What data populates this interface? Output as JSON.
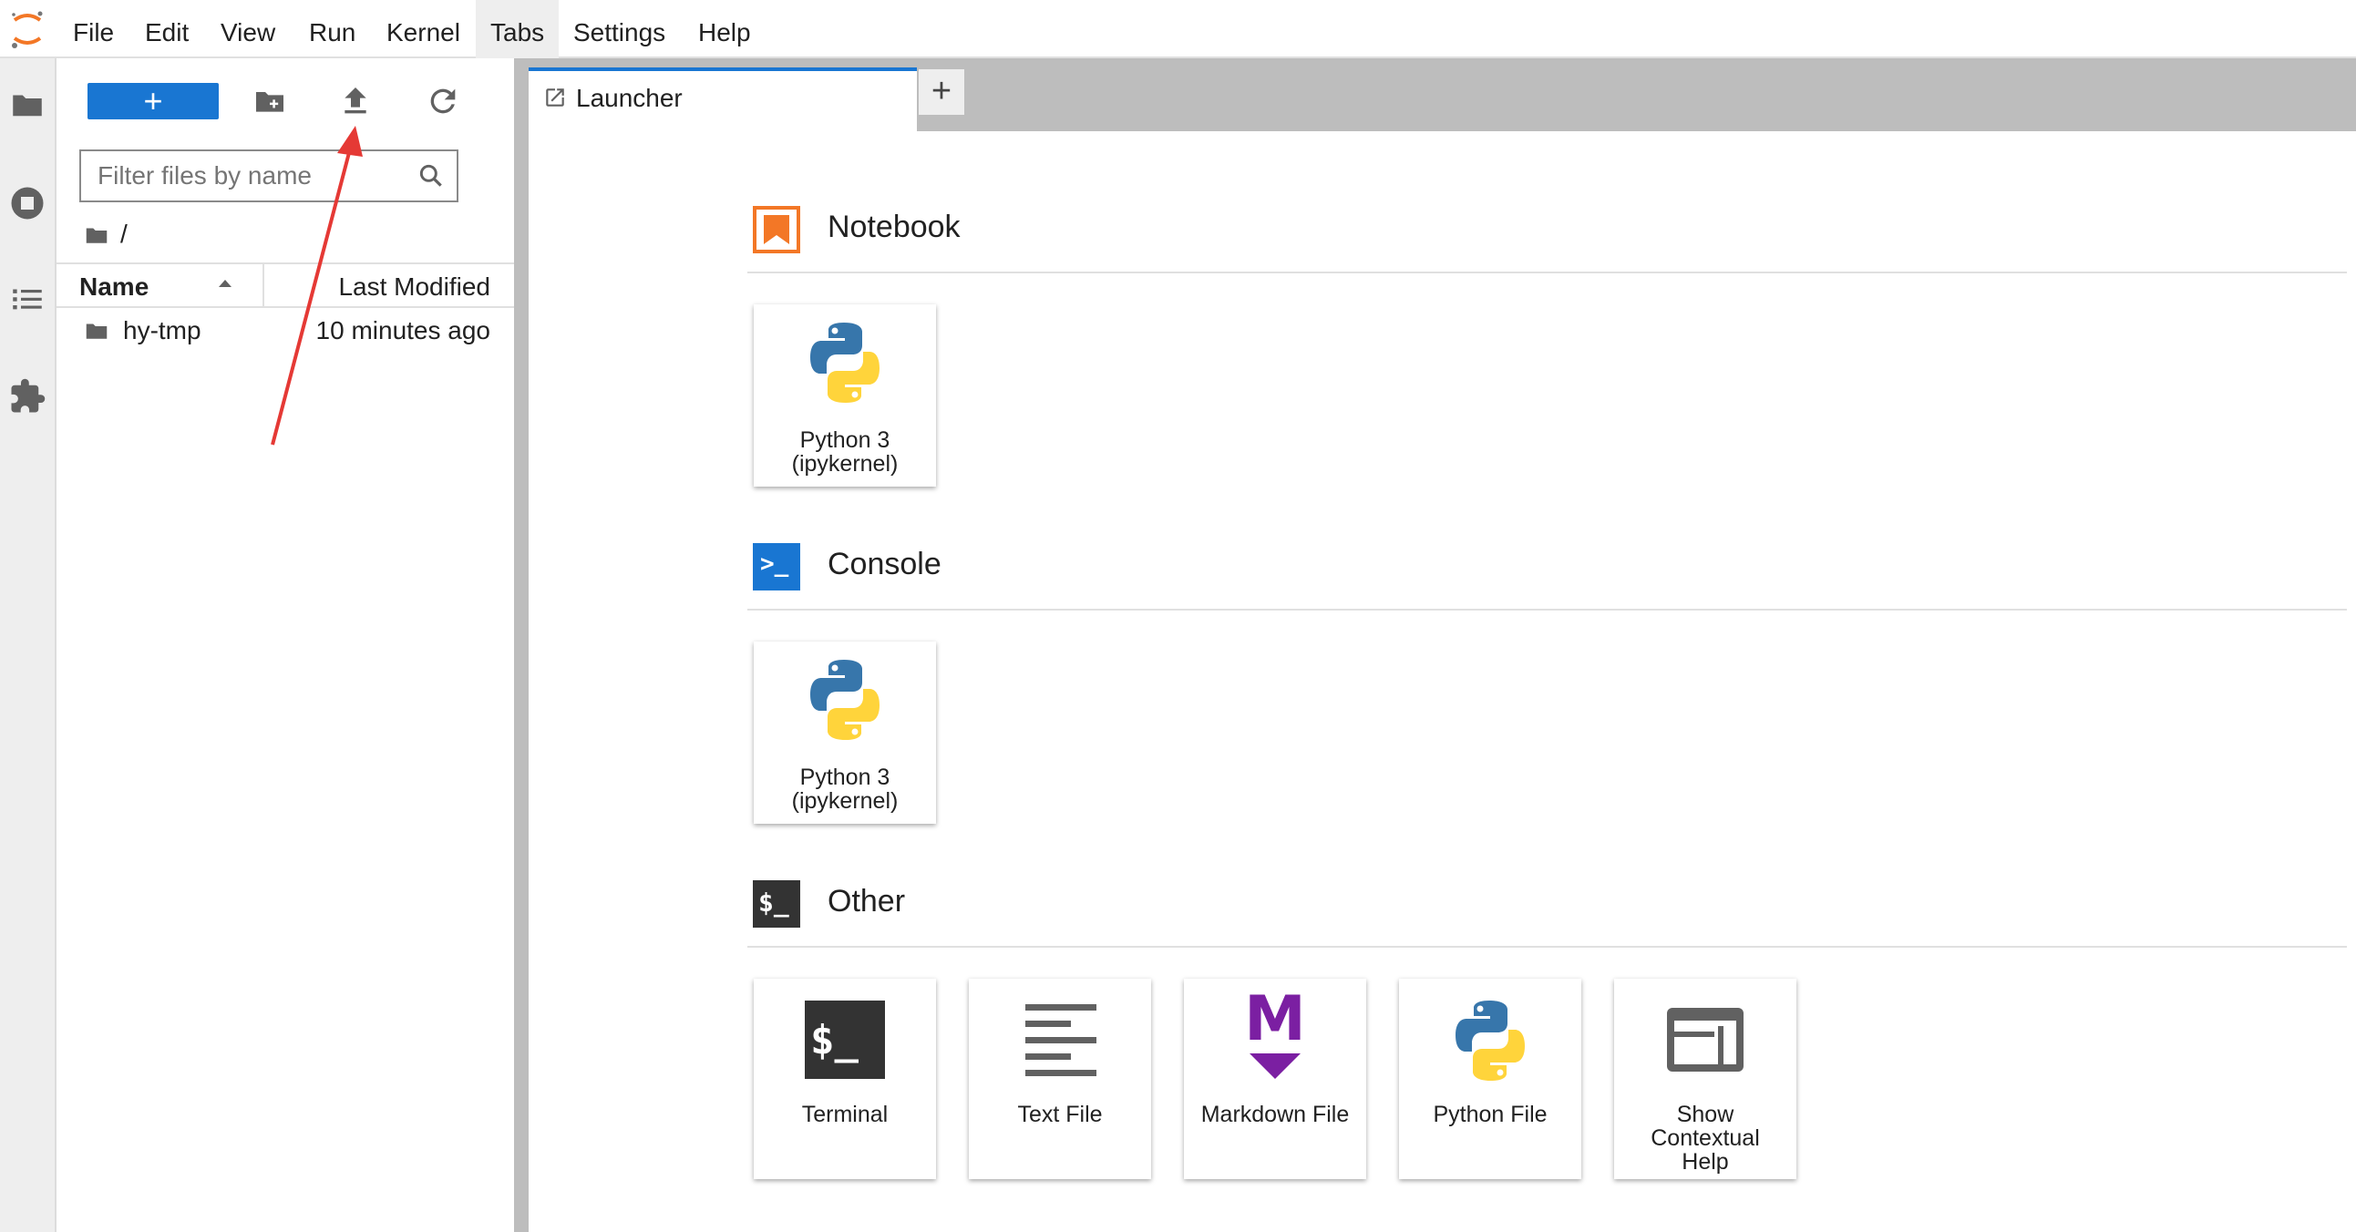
{
  "menubar": {
    "items": [
      "File",
      "Edit",
      "View",
      "Run",
      "Kernel",
      "Tabs",
      "Settings",
      "Help"
    ]
  },
  "filebrowser": {
    "new_button_label": "+",
    "filter_placeholder": "Filter files by name",
    "breadcrumb": "/",
    "columns": {
      "name": "Name",
      "modified": "Last Modified"
    },
    "rows": [
      {
        "name": "hy-tmp",
        "modified": "10 minutes ago"
      }
    ]
  },
  "tabs": {
    "active": "Launcher",
    "add_label": "+"
  },
  "launcher": {
    "sections": [
      {
        "title": "Notebook",
        "cards": [
          {
            "line1": "Python 3",
            "line2": "(ipykernel)"
          }
        ]
      },
      {
        "title": "Console",
        "cards": [
          {
            "line1": "Python 3",
            "line2": "(ipykernel)"
          }
        ]
      },
      {
        "title": "Other",
        "cards": [
          {
            "label": "Terminal"
          },
          {
            "label": "Text File"
          },
          {
            "label": "Markdown File"
          },
          {
            "label": "Python File"
          },
          {
            "line1": "Show",
            "line2": "Contextual",
            "line3": "Help"
          }
        ]
      }
    ],
    "console_icon_text": ">_",
    "other_icon_text": "$_",
    "terminal_icon_text": "$_",
    "markdown_icon_text": "M"
  },
  "colors": {
    "accent": "#1976d2",
    "notebook_orange": "#f37726",
    "markdown_purple": "#7b1fa2",
    "annotation_red": "#e53935"
  }
}
